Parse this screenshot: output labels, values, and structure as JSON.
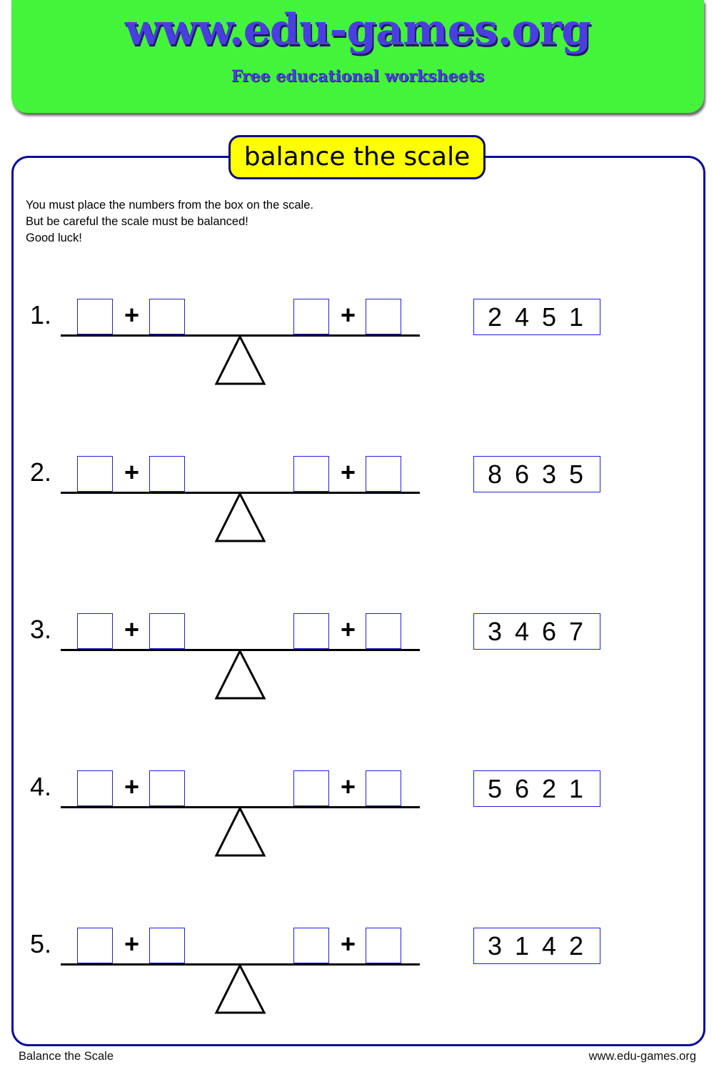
{
  "header": {
    "site_title": "www.edu-games.org",
    "subtitle": "Free educational worksheets",
    "background_color": "#44f43a",
    "title_color": "#4a3ee0"
  },
  "worksheet": {
    "title": "balance the scale",
    "instructions": [
      "You must place the numbers from the box on the scale.",
      "But be careful the scale must be balanced!",
      "Good luck!"
    ],
    "problems": [
      {
        "label": "1.",
        "operator": "+",
        "numbers": "2 4 5 1"
      },
      {
        "label": "2.",
        "operator": "+",
        "numbers": "8 6 3 5"
      },
      {
        "label": "3.",
        "operator": "+",
        "numbers": "3 4 6 7"
      },
      {
        "label": "4.",
        "operator": "+",
        "numbers": "5 6 2 1"
      },
      {
        "label": "5.",
        "operator": "+",
        "numbers": "3 1 4 2"
      }
    ]
  },
  "footer": {
    "left": "Balance the Scale",
    "right": "www.edu-games.org"
  }
}
